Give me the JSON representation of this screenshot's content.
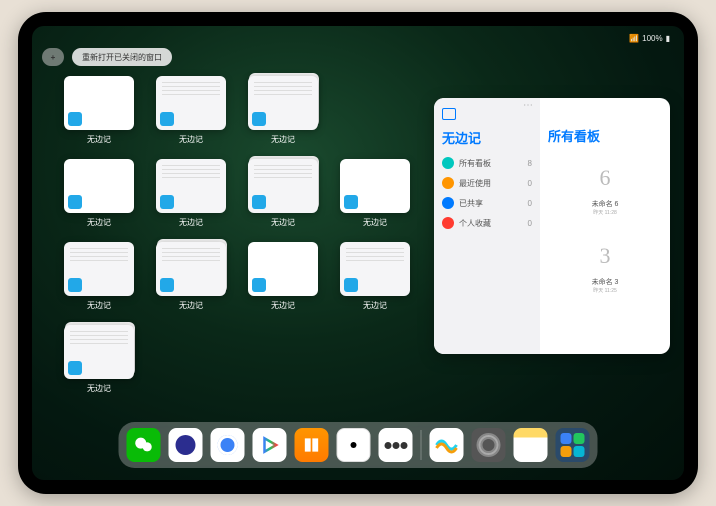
{
  "status": {
    "wifi": "📶",
    "battery": "100%"
  },
  "topbar": {
    "plus": "+",
    "reopen": "重新打开已关闭的窗口"
  },
  "thumbs": [
    {
      "label": "无边记",
      "variant": "blank",
      "stacked": false
    },
    {
      "label": "无边记",
      "variant": "detail",
      "stacked": false
    },
    {
      "label": "无边记",
      "variant": "detail",
      "stacked": true
    },
    {
      "label": "无边记",
      "variant": "blank",
      "stacked": false
    },
    {
      "label": "无边记",
      "variant": "detail",
      "stacked": false
    },
    {
      "label": "无边记",
      "variant": "detail",
      "stacked": true
    },
    {
      "label": "无边记",
      "variant": "blank",
      "stacked": false
    },
    {
      "label": "无边记",
      "variant": "detail",
      "stacked": false
    },
    {
      "label": "无边记",
      "variant": "detail",
      "stacked": true
    },
    {
      "label": "无边记",
      "variant": "blank",
      "stacked": false
    },
    {
      "label": "无边记",
      "variant": "detail",
      "stacked": false
    },
    {
      "label": "无边记",
      "variant": "detail",
      "stacked": true
    }
  ],
  "panel": {
    "left_title": "无边记",
    "items": [
      {
        "icon": "#00c7be",
        "label": "所有看板",
        "count": "8"
      },
      {
        "icon": "#ff9500",
        "label": "最近使用",
        "count": "0"
      },
      {
        "icon": "#007aff",
        "label": "已共享",
        "count": "0"
      },
      {
        "icon": "#ff3b30",
        "label": "个人收藏",
        "count": "0"
      }
    ],
    "right_title": "所有看板",
    "boards": [
      {
        "sketch": "6",
        "label": "未命名 6",
        "sub": "昨天 11:28"
      },
      {
        "sketch": "3",
        "label": "未命名 3",
        "sub": "昨天 11:25"
      }
    ],
    "ellipsis": "⋯"
  },
  "dock": [
    {
      "name": "wechat-icon",
      "cls": "wechat"
    },
    {
      "name": "quark-hd-icon",
      "cls": "quark-hd"
    },
    {
      "name": "quark-icon",
      "cls": "quark"
    },
    {
      "name": "play-icon",
      "cls": "play"
    },
    {
      "name": "books-icon",
      "cls": "books"
    },
    {
      "name": "dice-icon",
      "cls": "dice"
    },
    {
      "name": "filter-icon",
      "cls": "filter"
    },
    {
      "name": "sep"
    },
    {
      "name": "freeform-icon",
      "cls": "freeform"
    },
    {
      "name": "settings-icon",
      "cls": "settings"
    },
    {
      "name": "notes-icon",
      "cls": "notes"
    },
    {
      "name": "app-library-icon",
      "cls": "apps-grid"
    }
  ]
}
